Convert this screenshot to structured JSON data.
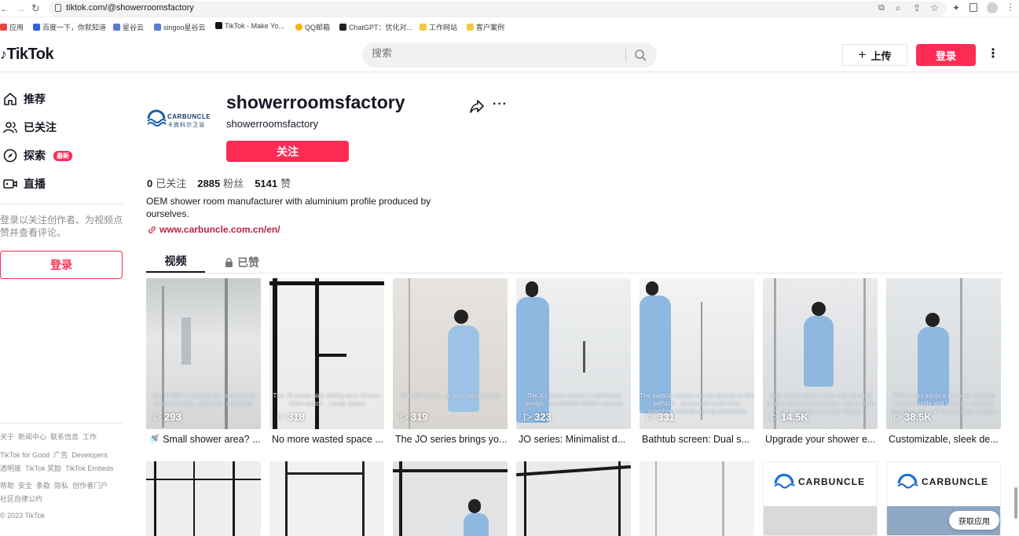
{
  "browser": {
    "url": "tiktok.com/@showerroomsfactory",
    "bookmarks": [
      "应用",
      "百度一下，你就知道",
      "星谷云",
      "singoo星谷云",
      "TikTok - Make Yo...",
      "QQ邮箱",
      "ChatGPT：优化对...",
      "工作网站",
      "客户案例"
    ]
  },
  "header": {
    "logo": "TikTok",
    "search_placeholder": "搜索",
    "upload_label": "上传",
    "login_label": "登录"
  },
  "sidebar": {
    "items": [
      {
        "label": "推荐",
        "icon": "home-icon"
      },
      {
        "label": "已关注",
        "icon": "following-icon"
      },
      {
        "label": "探索",
        "icon": "compass-icon",
        "badge": "最新"
      },
      {
        "label": "直播",
        "icon": "live-icon"
      }
    ],
    "login_prompt": "登录以关注创作者、为视频点赞并查看评论。",
    "login_button": "登录",
    "footer": [
      [
        "关于",
        "新闻中心",
        "联系信息",
        "工作"
      ],
      [
        "TikTok for Good",
        "广告",
        "Developers"
      ],
      [
        "透明度",
        "TikTok 奖励",
        "TikTok Embeds"
      ],
      [
        "帮助",
        "安全",
        "条款",
        "隐私",
        "创作者门户"
      ],
      [
        "社区自律公约"
      ],
      [
        "© 2023 TikTok"
      ]
    ]
  },
  "profile": {
    "avatar_brand": "CARBUNCLE",
    "avatar_sub": "卡宾科尔卫浴",
    "username": "showerroomsfactory",
    "nickname": "showerroomsfactory",
    "follow_label": "关注",
    "stats": [
      {
        "value": "0",
        "label": "已关注"
      },
      {
        "value": "2885",
        "label": "粉丝"
      },
      {
        "value": "5141",
        "label": "赞"
      }
    ],
    "bio": "OEM shower room manufacturer with aluminium profile produced by ourselves.",
    "link": "www.carbuncle.com.cn/en/"
  },
  "tabs": {
    "videos": "视频",
    "liked": "已赞"
  },
  "videos": [
    {
      "views": "293",
      "overlay": "Our JU625 is suitable for small-sized shower areas ...ged door openings",
      "caption": "Small shower area? ..."
    },
    {
      "views": "318",
      "overlay": "The JS series side sliding door shower room switch ...ccupy space",
      "caption": "No more wasted space ..."
    },
    {
      "views": "319",
      "overlay": "The JO series ...a minimalist design",
      "caption": "The JO series brings yo..."
    },
    {
      "views": "323",
      "overlay": "The JO series adopts a minimalist design ...installation hidden screws",
      "caption": "JO series: Minimalist d..."
    },
    {
      "views": "331",
      "overlay": "The bathtub screen can be placed on the bathtub ...to prevent water from splashing outside during showering",
      "caption": "Bathtub screen: Dual s..."
    },
    {
      "views": "14.5K",
      "overlay": "JMB series adopt a two-way opening design inside and outside ...top bottom axes and narrow edge design",
      "caption": "Upgrade your shower e..."
    },
    {
      "views": "38.5K",
      "overlay": "JMB series adopt a two-way opening design inside and outside ...op and bottom axes and narrow edge design",
      "caption": "Customizable, sleek de..."
    }
  ],
  "row2_brand": "CARBUNCLE",
  "get_app": "获取应用"
}
